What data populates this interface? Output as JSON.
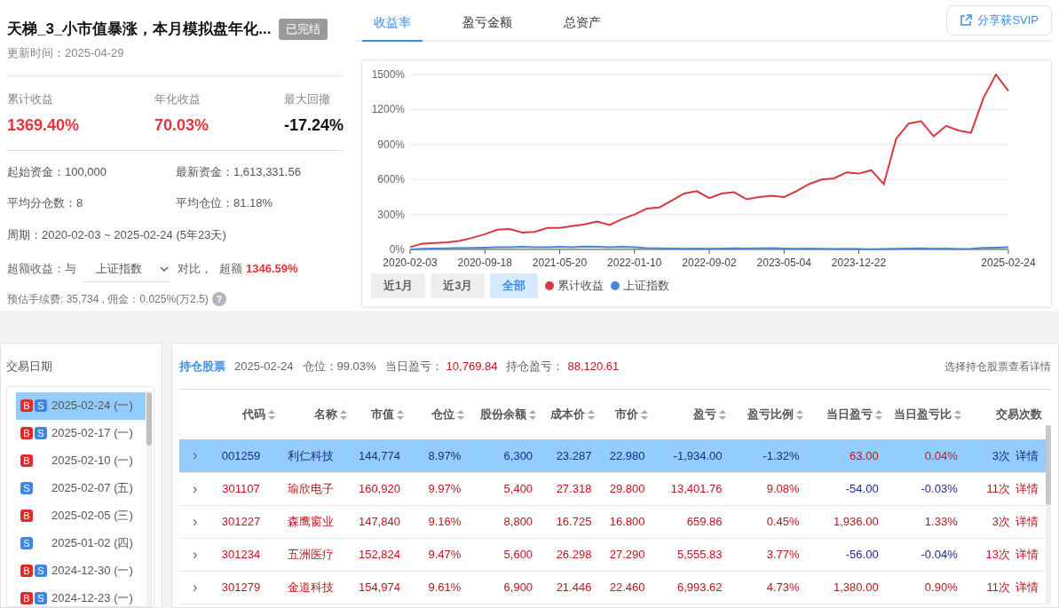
{
  "summary": {
    "title": "天梯_3_小市值暴涨，本月模拟盘年化...",
    "status": "已完结",
    "updated": "更新时间：2025-04-29",
    "metrics": [
      {
        "label": "累计收益",
        "value": "1369.40%",
        "color": "#e8333a"
      },
      {
        "label": "年化收益",
        "value": "70.03%",
        "color": "#e8333a"
      },
      {
        "label": "最大回撤",
        "value": "-17.24%",
        "color": "#111111"
      }
    ],
    "info": [
      "起始资金：100,000",
      "最新资金：1,613,331.56",
      "平均分仓数：8",
      "平均仓位：81.18%"
    ],
    "period": "周期：2020-02-03 ~ 2025-02-24 (5年23天)",
    "excess": {
      "label": "超额收益：与",
      "benchmark": "上证指数",
      "compare": "对比，",
      "excess_label": "超额",
      "excess_value": "1346.59%"
    },
    "fee": "预估手续费: 35,734 , 佣金：0.025%(万2.5)",
    "help": "?"
  },
  "chart_tabs": [
    {
      "label": "收益率",
      "selected": true
    },
    {
      "label": "盈亏金额",
      "selected": false
    },
    {
      "label": "总资产",
      "selected": false
    }
  ],
  "share_button": "分享获SVIP",
  "chart": {
    "chart_data": {
      "type": "line",
      "categories": [
        "2020-02-03",
        null,
        null,
        null,
        null,
        null,
        "2020-09-18",
        null,
        null,
        null,
        null,
        null,
        "2021-05-20",
        null,
        null,
        null,
        null,
        null,
        "2022-01-10",
        null,
        null,
        null,
        null,
        null,
        "2022-09-02",
        null,
        null,
        null,
        null,
        null,
        "2023-05-04",
        null,
        null,
        null,
        null,
        null,
        "2023-12-22",
        null,
        null,
        null,
        null,
        null,
        null,
        null,
        null,
        null,
        null,
        null,
        "2025-02-24"
      ],
      "yticks": [
        {
          "value": 0,
          "label": "0%"
        },
        {
          "value": 300,
          "label": "300%"
        },
        {
          "value": 600,
          "label": "600%"
        },
        {
          "value": 900,
          "label": "900%"
        },
        {
          "value": 1200,
          "label": "1200%"
        },
        {
          "value": 1500,
          "label": "1500%"
        }
      ],
      "ylim": [
        0,
        1500
      ],
      "grid": true,
      "series": [
        {
          "name": "累计收益",
          "color": "#d9363e",
          "values": [
            20,
            50,
            55,
            60,
            75,
            100,
            130,
            170,
            175,
            145,
            150,
            185,
            185,
            200,
            215,
            240,
            210,
            260,
            300,
            350,
            360,
            420,
            480,
            500,
            440,
            480,
            490,
            430,
            450,
            460,
            450,
            500,
            560,
            600,
            610,
            660,
            650,
            680,
            560,
            950,
            1080,
            1100,
            970,
            1060,
            1020,
            1000,
            1300,
            1500,
            1360
          ]
        },
        {
          "name": "上证指数",
          "color": "#4a86d8",
          "values": [
            0,
            5,
            8,
            10,
            12,
            14,
            15,
            18,
            20,
            22,
            20,
            18,
            22,
            20,
            24,
            22,
            20,
            22,
            18,
            12,
            10,
            8,
            6,
            8,
            6,
            8,
            10,
            8,
            10,
            12,
            8,
            6,
            8,
            6,
            4,
            6,
            4,
            2,
            4,
            6,
            8,
            10,
            6,
            8,
            4,
            6,
            14,
            16,
            18
          ]
        }
      ]
    },
    "ranges": [
      {
        "label": "近1月",
        "selected": false
      },
      {
        "label": "近3月",
        "selected": false
      },
      {
        "label": "全部",
        "selected": true
      }
    ]
  },
  "dates": {
    "title": "交易日期",
    "items": [
      {
        "buy": "B",
        "sell": "S",
        "date": "2025-02-24",
        "weekday": "(一)",
        "selected": true
      },
      {
        "buy": "B",
        "sell": "S",
        "date": "2025-02-17",
        "weekday": "(一)",
        "selected": false
      },
      {
        "buy": "B",
        "date": "2025-02-10",
        "weekday": "(一)",
        "selected": false
      },
      {
        "sell": "S",
        "date": "2025-02-07",
        "weekday": "(五)",
        "selected": false
      },
      {
        "buy": "B",
        "date": "2025-02-05",
        "weekday": "(三)",
        "selected": false
      },
      {
        "sell": "S",
        "date": "2025-01-02",
        "weekday": "(四)",
        "selected": false
      },
      {
        "buy": "B",
        "sell": "S",
        "date": "2024-12-30",
        "weekday": "(一)",
        "selected": false
      },
      {
        "buy": "B",
        "sell": "S",
        "date": "2024-12-23",
        "weekday": "(一)",
        "selected": false
      }
    ]
  },
  "holdings": {
    "title": "持仓股票",
    "date": "2025-02-24",
    "position": "仓位：99.03%",
    "day_label": "当日盈亏：",
    "day_value": "10,769.84",
    "hold_label": "持仓盈亏：",
    "hold_value": "88,120.61",
    "hint": "选择持仓股票查看详情",
    "columns": [
      {
        "label": "代码",
        "sortable": true
      },
      {
        "label": "名称",
        "sortable": true
      },
      {
        "label": "市值",
        "sortable": true
      },
      {
        "label": "仓位",
        "sortable": true
      },
      {
        "label": "股份余额",
        "sortable": true
      },
      {
        "label": "成本价",
        "sortable": true
      },
      {
        "label": "市价",
        "sortable": true
      },
      {
        "label": "盈亏",
        "sortable": true
      },
      {
        "label": "盈亏比例",
        "sortable": true
      },
      {
        "label": "当日盈亏",
        "sortable": true
      },
      {
        "label": "当日盈亏比",
        "sortable": true
      },
      {
        "label": "交易次数",
        "sortable": false
      }
    ],
    "rows": [
      {
        "selected": true,
        "expander": "›",
        "cells": [
          {
            "text": "001259",
            "color": "#1c2a8c"
          },
          {
            "text": "利仁科技",
            "color": "#1c2a8c"
          },
          {
            "text": "144,774",
            "color": "#1c2a8c"
          },
          {
            "text": "8.97%",
            "color": "#1c2a8c"
          },
          {
            "text": "6,300",
            "color": "#1c2a8c"
          },
          {
            "text": "23.287",
            "color": "#1c2a8c"
          },
          {
            "text": "22.980",
            "color": "#1c2a8c"
          },
          {
            "text": "-1,934.00",
            "color": "#1c2a8c"
          },
          {
            "text": "-1.32%",
            "color": "#1c2a8c"
          },
          {
            "text": "63.00",
            "color": "#c0141c"
          },
          {
            "text": "0.04%",
            "color": "#c0141c"
          },
          {
            "text": "3次",
            "color": "#1c2a8c"
          }
        ],
        "detail": "详情"
      },
      {
        "selected": false,
        "expander": "›",
        "cells": [
          {
            "text": "301107",
            "color": "#c0141c"
          },
          {
            "text": "瑜欣电子",
            "color": "#c0141c"
          },
          {
            "text": "160,920",
            "color": "#c0141c"
          },
          {
            "text": "9.97%",
            "color": "#c0141c"
          },
          {
            "text": "5,400",
            "color": "#c0141c"
          },
          {
            "text": "27.318",
            "color": "#c0141c"
          },
          {
            "text": "29.800",
            "color": "#c0141c"
          },
          {
            "text": "13,401.76",
            "color": "#c0141c"
          },
          {
            "text": "9.08%",
            "color": "#c0141c"
          },
          {
            "text": "-54.00",
            "color": "#1c2a8c"
          },
          {
            "text": "-0.03%",
            "color": "#1c2a8c"
          },
          {
            "text": "11次",
            "color": "#c0141c"
          }
        ],
        "detail": "详情"
      },
      {
        "selected": false,
        "expander": "›",
        "cells": [
          {
            "text": "301227",
            "color": "#c0141c"
          },
          {
            "text": "森鹰窗业",
            "color": "#c0141c"
          },
          {
            "text": "147,840",
            "color": "#c0141c"
          },
          {
            "text": "9.16%",
            "color": "#c0141c"
          },
          {
            "text": "8,800",
            "color": "#c0141c"
          },
          {
            "text": "16.725",
            "color": "#c0141c"
          },
          {
            "text": "16.800",
            "color": "#c0141c"
          },
          {
            "text": "659.86",
            "color": "#c0141c"
          },
          {
            "text": "0.45%",
            "color": "#c0141c"
          },
          {
            "text": "1,936.00",
            "color": "#c0141c"
          },
          {
            "text": "1.33%",
            "color": "#c0141c"
          },
          {
            "text": "3次",
            "color": "#c0141c"
          }
        ],
        "detail": "详情"
      },
      {
        "selected": false,
        "expander": "›",
        "cells": [
          {
            "text": "301234",
            "color": "#c0141c"
          },
          {
            "text": "五洲医疗",
            "color": "#c0141c"
          },
          {
            "text": "152,824",
            "color": "#c0141c"
          },
          {
            "text": "9.47%",
            "color": "#c0141c"
          },
          {
            "text": "5,600",
            "color": "#c0141c"
          },
          {
            "text": "26.298",
            "color": "#c0141c"
          },
          {
            "text": "27.290",
            "color": "#c0141c"
          },
          {
            "text": "5,555.83",
            "color": "#c0141c"
          },
          {
            "text": "3.77%",
            "color": "#c0141c"
          },
          {
            "text": "-56.00",
            "color": "#1c2a8c"
          },
          {
            "text": "-0.04%",
            "color": "#1c2a8c"
          },
          {
            "text": "13次",
            "color": "#c0141c"
          }
        ],
        "detail": "详情"
      },
      {
        "selected": false,
        "expander": "›",
        "cells": [
          {
            "text": "301279",
            "color": "#c0141c"
          },
          {
            "text": "金道科技",
            "color": "#c0141c"
          },
          {
            "text": "154,974",
            "color": "#c0141c"
          },
          {
            "text": "9.61%",
            "color": "#c0141c"
          },
          {
            "text": "6,900",
            "color": "#c0141c"
          },
          {
            "text": "21.446",
            "color": "#c0141c"
          },
          {
            "text": "22.460",
            "color": "#c0141c"
          },
          {
            "text": "6,993.62",
            "color": "#c0141c"
          },
          {
            "text": "4.73%",
            "color": "#c0141c"
          },
          {
            "text": "1,380.00",
            "color": "#c0141c"
          },
          {
            "text": "0.90%",
            "color": "#c0141c"
          },
          {
            "text": "11次",
            "color": "#c0141c"
          }
        ],
        "detail": "详情"
      }
    ]
  }
}
